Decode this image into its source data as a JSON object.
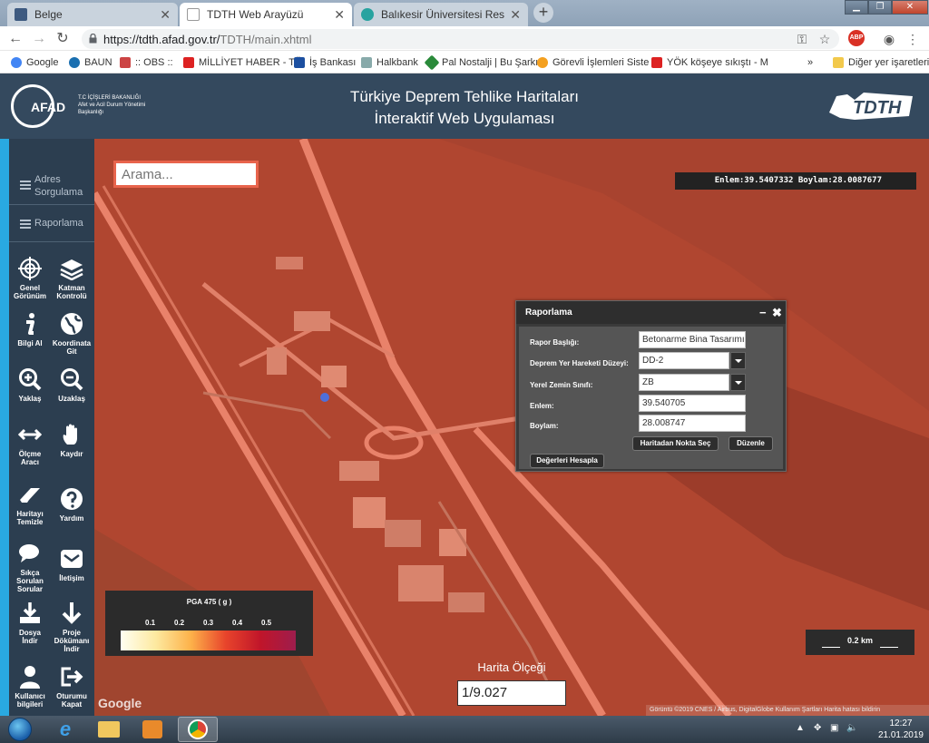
{
  "browser": {
    "tabs": [
      {
        "label": "Belge",
        "favicon": "document-icon"
      },
      {
        "label": "TDTH Web Arayüzü",
        "favicon": "tdth-icon",
        "active": true
      },
      {
        "label": "Balıkesir Üniversitesi Resmi Web",
        "favicon": "globe-icon"
      }
    ],
    "url_main": "https://tdth.afad.gov.tr/",
    "url_path": "TDTH/main.xhtml",
    "bookmarks": [
      {
        "label": "Google"
      },
      {
        "label": "BAUN"
      },
      {
        "label": ":: OBS ::"
      },
      {
        "label": "MİLLİYET HABER - TÜ"
      },
      {
        "label": "İş Bankası"
      },
      {
        "label": "Halkbank"
      },
      {
        "label": "Pal Nostalji | Bu Şarkı"
      },
      {
        "label": "Görevli İşlemleri Siste"
      },
      {
        "label": "YÖK köşeye sıkıştı - M"
      }
    ],
    "other_bookmarks": "Diğer yer işaretleri",
    "abp_label": "ABP"
  },
  "header": {
    "org_abbr": "AFAD",
    "org_name": "T.C İÇİŞLERİ BAKANLIĞI",
    "org_subtitle": "Afet ve Acil Durum Yönetimi Başkanlığı",
    "title_line1": "Türkiye Deprem Tehlike Haritaları",
    "title_line2": "İnteraktif Web Uygulaması",
    "right_logo": "TDTH"
  },
  "sidebar": {
    "links": [
      {
        "label_1": "Adres",
        "label_2": "Sorgulama"
      },
      {
        "label_1": "Raporlama"
      }
    ],
    "tools": [
      {
        "label_1": "Genel",
        "label_2": "Görünüm",
        "icon": "crosshair-icon"
      },
      {
        "label_1": "Katman",
        "label_2": "Kontrolü",
        "icon": "layers-icon"
      },
      {
        "label_1": "Bilgi Al",
        "icon": "info-icon"
      },
      {
        "label_1": "Koordinata",
        "label_2": "Git",
        "icon": "globe-icon"
      },
      {
        "label_1": "Yaklaş",
        "icon": "zoom-in-icon"
      },
      {
        "label_1": "Uzaklaş",
        "icon": "zoom-out-icon"
      },
      {
        "label_1": "Ölçme",
        "label_2": "Aracı",
        "icon": "measure-icon"
      },
      {
        "label_1": "Kaydır",
        "icon": "hand-icon"
      },
      {
        "label_1": "Haritayı",
        "label_2": "Temizle",
        "icon": "eraser-icon"
      },
      {
        "label_1": "Yardım",
        "icon": "help-icon"
      },
      {
        "label_1": "Sıkça",
        "label_2": "Sorulan",
        "label_3": "Sorular",
        "icon": "chat-icon"
      },
      {
        "label_1": "İletişim",
        "icon": "mail-icon"
      },
      {
        "label_1": "Dosya",
        "label_2": "İndir",
        "icon": "download-icon"
      },
      {
        "label_1": "Proje",
        "label_2": "Dökümanı",
        "label_3": "İndir",
        "icon": "download-arrow-icon"
      },
      {
        "label_1": "Kullanıcı",
        "label_2": "bilgileri",
        "icon": "user-icon"
      },
      {
        "label_1": "Oturumu",
        "label_2": "Kapat",
        "icon": "logout-icon"
      }
    ]
  },
  "map": {
    "search_placeholder": "Arama...",
    "coords": "Enlem:39.5407332 Boylam:28.0087677",
    "legend": {
      "title": "PGA 475 ( g )",
      "ticks": [
        "0.1",
        "0.2",
        "0.3",
        "0.4",
        "0.5"
      ]
    },
    "scale_bar": "0.2 km",
    "map_scale_label": "Harita Ölçeği",
    "map_scale_value": "1/9.027",
    "google": "Google",
    "attribution": "Görüntü ©2019 CNES / Airbus, DigitalGlobe  Kullanım Şartları  Harita hatası bildirin"
  },
  "report_panel": {
    "title": "Raporlama",
    "fields": {
      "report_title_label": "Rapor Başlığı:",
      "report_title_value": "Betonarme Bina Tasarımı",
      "ground_motion_label": "Deprem Yer Hareketi Düzeyi:",
      "ground_motion_value": "DD-2",
      "soil_class_label": "Yerel Zemin Sınıfı:",
      "soil_class_value": "ZB",
      "lat_label": "Enlem:",
      "lat_value": "39.540705",
      "lon_label": "Boylam:",
      "lon_value": "28.008747"
    },
    "buttons": {
      "select_point": "Haritadan Nokta Seç",
      "edit": "Düzenle",
      "calculate": "Değerleri Hesapla"
    }
  },
  "taskbar": {
    "time": "12:27",
    "date": "21.01.2019"
  },
  "colors": {
    "header_bg": "#34495e",
    "sidebar_bg": "#2c3e50",
    "sidebar_accent": "#29a9e1",
    "map_tint": "#b34a34"
  }
}
